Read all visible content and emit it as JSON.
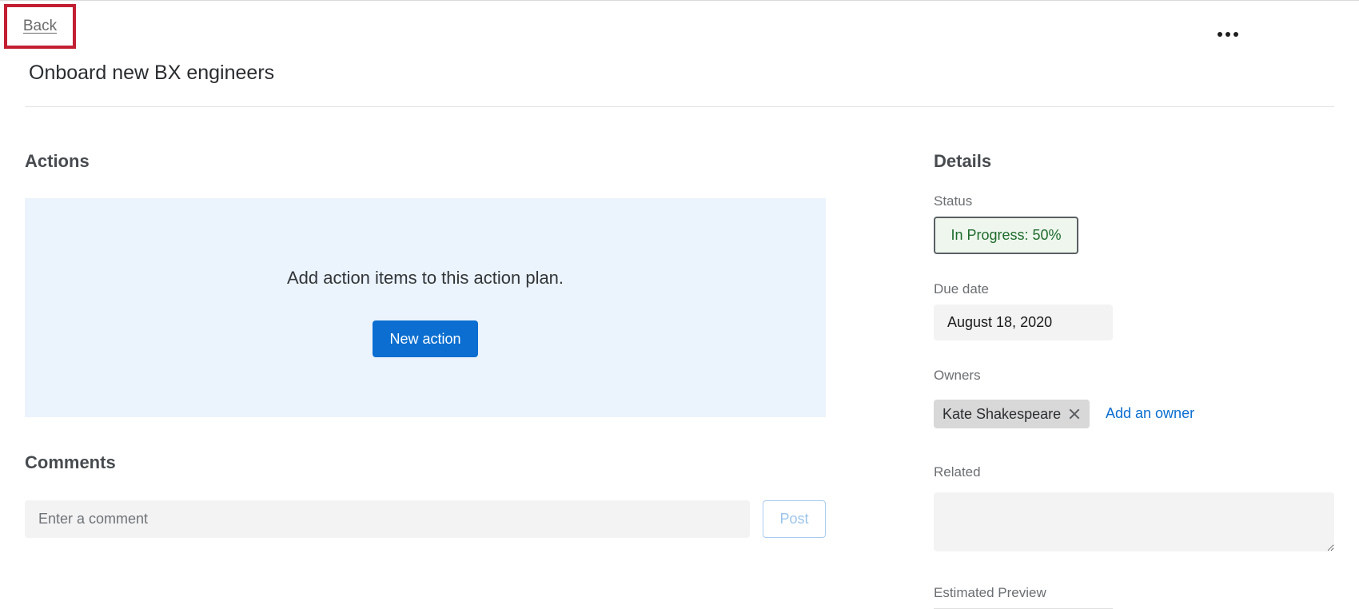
{
  "header": {
    "back_label": "Back",
    "title": "Onboard new BX engineers",
    "more_menu_icon": "more-horizontal-icon"
  },
  "actions": {
    "heading": "Actions",
    "empty_text": "Add action items to this action plan.",
    "new_action_label": "New action"
  },
  "comments": {
    "heading": "Comments",
    "input_placeholder": "Enter a comment",
    "input_value": "",
    "post_label": "Post"
  },
  "details": {
    "heading": "Details",
    "status_label": "Status",
    "status_value": "In Progress: 50%",
    "due_date_label": "Due date",
    "due_date_value": "August 18, 2020",
    "owners_label": "Owners",
    "owners": [
      {
        "name": "Kate Shakespeare"
      }
    ],
    "add_owner_label": "Add an owner",
    "related_label": "Related",
    "related_value": "",
    "estimated_preview_label": "Estimated Preview"
  },
  "colors": {
    "accent": "#0b6ed0",
    "highlight_border": "#c21f32",
    "actions_panel_bg": "#ebf3fc",
    "status_text": "#1e6b2c"
  }
}
